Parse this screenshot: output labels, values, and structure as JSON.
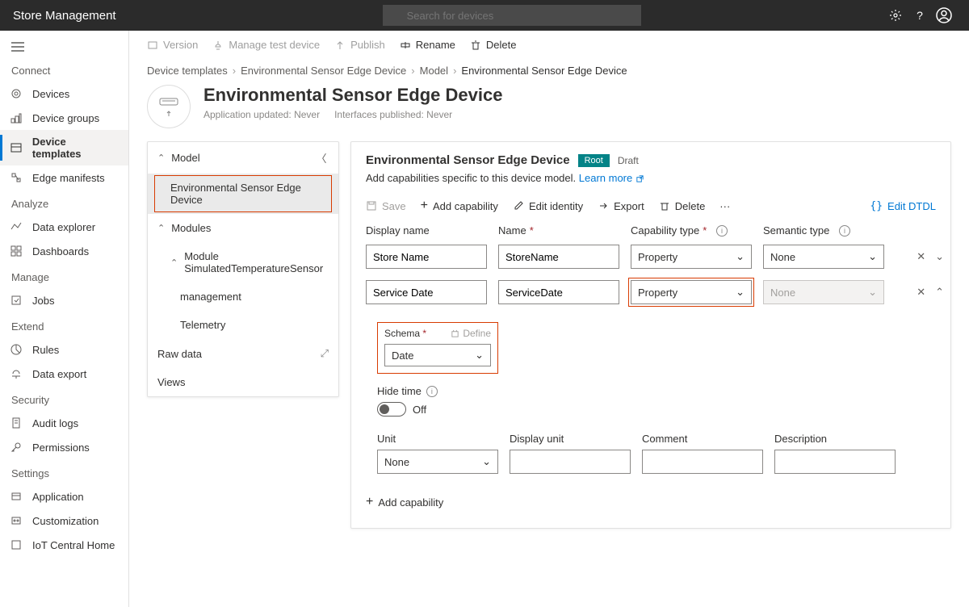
{
  "topbar": {
    "title": "Store Management",
    "search_placeholder": "Search for devices"
  },
  "toolbar": {
    "version": "Version",
    "manage_test_device": "Manage test device",
    "publish": "Publish",
    "rename": "Rename",
    "delete": "Delete"
  },
  "nav": {
    "groups": [
      {
        "label": "Connect",
        "items": [
          {
            "key": "devices",
            "label": "Devices"
          },
          {
            "key": "device-groups",
            "label": "Device groups"
          },
          {
            "key": "device-templates",
            "label": "Device templates",
            "active": true
          },
          {
            "key": "edge-manifests",
            "label": "Edge manifests"
          }
        ]
      },
      {
        "label": "Analyze",
        "items": [
          {
            "key": "data-explorer",
            "label": "Data explorer"
          },
          {
            "key": "dashboards",
            "label": "Dashboards"
          }
        ]
      },
      {
        "label": "Manage",
        "items": [
          {
            "key": "jobs",
            "label": "Jobs"
          }
        ]
      },
      {
        "label": "Extend",
        "items": [
          {
            "key": "rules",
            "label": "Rules"
          },
          {
            "key": "data-export",
            "label": "Data export"
          }
        ]
      },
      {
        "label": "Security",
        "items": [
          {
            "key": "audit-logs",
            "label": "Audit logs"
          },
          {
            "key": "permissions",
            "label": "Permissions"
          }
        ]
      },
      {
        "label": "Settings",
        "items": [
          {
            "key": "application",
            "label": "Application"
          },
          {
            "key": "customization",
            "label": "Customization"
          },
          {
            "key": "iot-central-home",
            "label": "IoT Central Home"
          }
        ]
      }
    ]
  },
  "breadcrumb": {
    "items": [
      "Device templates",
      "Environmental Sensor Edge Device",
      "Model"
    ],
    "current": "Environmental Sensor Edge Device"
  },
  "header": {
    "title": "Environmental Sensor Edge Device",
    "app_updated": "Application updated: Never",
    "interfaces_published": "Interfaces published: Never"
  },
  "tree": {
    "model": "Model",
    "device": "Environmental Sensor Edge Device",
    "modules": "Modules",
    "module1": "Module SimulatedTemperatureSensor",
    "management": "management",
    "telemetry": "Telemetry",
    "raw_data": "Raw data",
    "views": "Views"
  },
  "editor": {
    "title": "Environmental Sensor Edge Device",
    "tag_root": "Root",
    "tag_draft": "Draft",
    "helper": "Add capabilities specific to this device model. ",
    "learn_more": "Learn more",
    "actions": {
      "save": "Save",
      "add_capability": "Add capability",
      "edit_identity": "Edit identity",
      "export": "Export",
      "delete": "Delete",
      "more": "···",
      "edit_dtdl": "Edit DTDL"
    },
    "columns": {
      "display_name": "Display name",
      "name": "Name",
      "capability_type": "Capability type",
      "semantic_type": "Semantic type"
    },
    "rows": [
      {
        "display": "Store Name",
        "name": "StoreName",
        "cap_type": "Property",
        "semantic": "None"
      },
      {
        "display": "Service Date",
        "name": "ServiceDate",
        "cap_type": "Property",
        "semantic": "None",
        "semantic_disabled": true
      }
    ],
    "detail": {
      "schema_label": "Schema",
      "define": "Define",
      "schema_value": "Date",
      "hide_time_label": "Hide time",
      "hide_time_state": "Off",
      "unit_label": "Unit",
      "unit_value": "None",
      "display_unit_label": "Display unit",
      "display_unit_value": "",
      "comment_label": "Comment",
      "comment_value": "",
      "description_label": "Description",
      "description_value": ""
    },
    "add_capability_bottom": "Add capability"
  }
}
